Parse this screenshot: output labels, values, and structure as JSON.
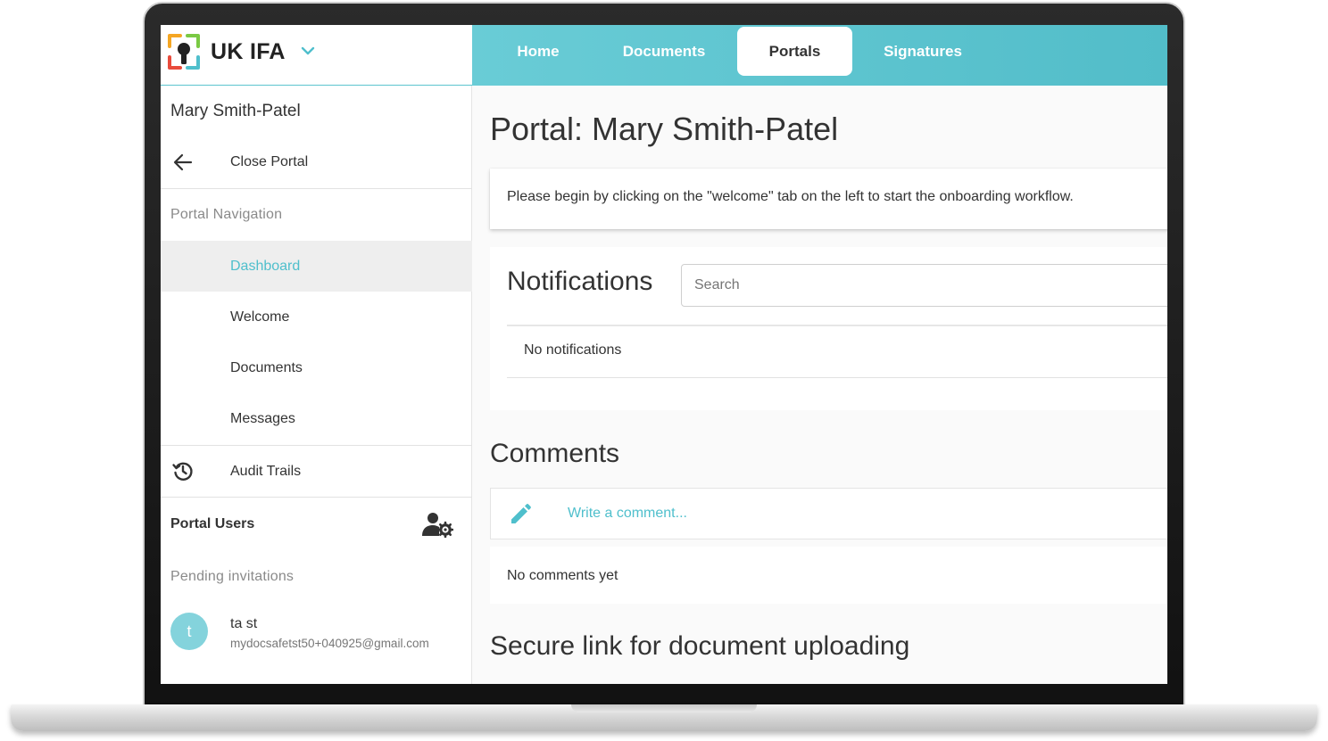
{
  "brand": {
    "name": "UK IFA"
  },
  "colors": {
    "accent": "#52bdc9",
    "accent_text": "#4fbfcc",
    "avatar": "#84d3dc"
  },
  "sidebar": {
    "user_name": "Mary Smith-Patel",
    "close_portal": "Close Portal",
    "nav_section_title": "Portal Navigation",
    "nav_items": [
      {
        "label": "Dashboard",
        "active": true
      },
      {
        "label": "Welcome"
      },
      {
        "label": "Documents"
      },
      {
        "label": "Messages"
      }
    ],
    "audit_trails": "Audit Trails",
    "portal_users": "Portal Users",
    "pending_title": "Pending invitations",
    "pending": [
      {
        "initial": "t",
        "name": "ta st",
        "email": "mydocsafetst50+040925@gmail.com"
      }
    ]
  },
  "topnav": {
    "tabs": [
      {
        "label": "Home"
      },
      {
        "label": "Documents"
      },
      {
        "label": "Portals",
        "active": true
      },
      {
        "label": "Signatures"
      }
    ]
  },
  "main": {
    "title": "Portal: Mary Smith-Patel",
    "alert": "Please begin by clicking on the \"welcome\" tab on the left to start the onboarding workflow.",
    "notifications": {
      "title": "Notifications",
      "search_placeholder": "Search",
      "empty": "No notifications"
    },
    "comments": {
      "title": "Comments",
      "write_prompt": "Write a comment...",
      "empty": "No comments yet"
    },
    "secure_link_title": "Secure link for document uploading"
  }
}
